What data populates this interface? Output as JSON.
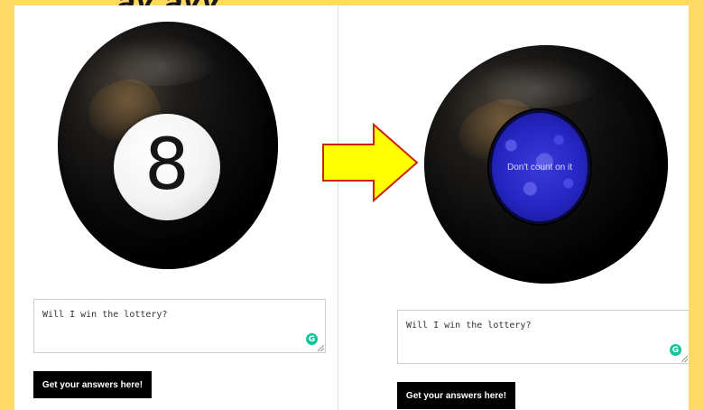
{
  "before": {
    "ball_number": "8",
    "question_value": "Will I win the lottery?",
    "button_label": "Get your answers here!",
    "grammarly_badge": "G"
  },
  "after": {
    "answer_text": "Don't count on it",
    "question_value": "Will I win the lottery?",
    "button_label": "Get your answers here!",
    "grammarly_badge": "G"
  },
  "colors": {
    "background": "#ffd966",
    "arrow_fill": "#ffff00",
    "arrow_stroke": "#cc2200",
    "answer_window": "#2626c4",
    "button": "#000000",
    "grammarly": "#15c39a"
  },
  "icons": [
    "magic-8-ball-icon",
    "right-arrow-icon",
    "grammarly-icon"
  ]
}
